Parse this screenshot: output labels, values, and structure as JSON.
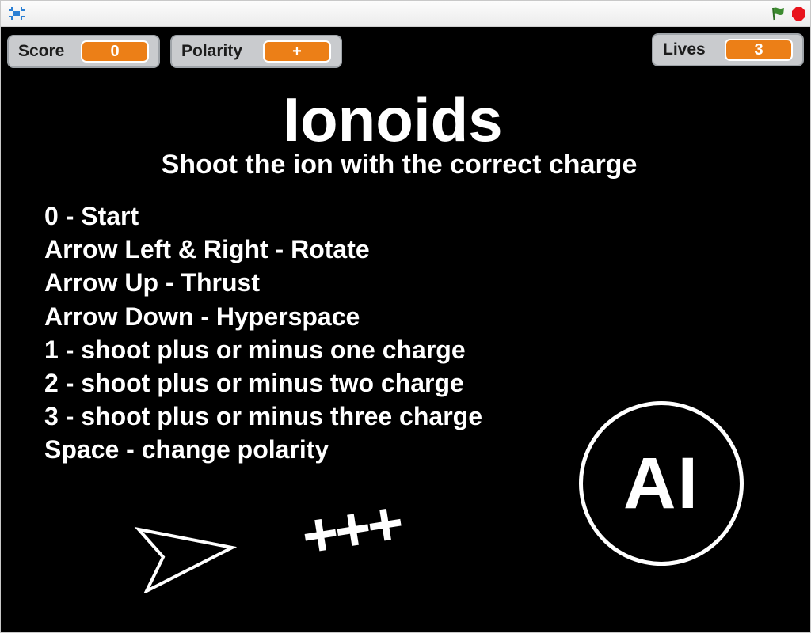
{
  "toolbar": {
    "fullscreen_icon": "fullscreen-icon",
    "green_flag_icon": "green-flag-icon",
    "stop_icon": "stop-sign-icon",
    "colors": {
      "fullscreen": "#2a7fd4",
      "flag": "#3c8a2f",
      "stop": "#e8141c"
    }
  },
  "monitors": {
    "score": {
      "label": "Score",
      "value": "0"
    },
    "polarity": {
      "label": "Polarity",
      "value": "+"
    },
    "lives": {
      "label": "Lives",
      "value": "3"
    },
    "colors": {
      "monitor_bg": "#c9cbce",
      "value_bg": "#ec7f17"
    }
  },
  "stage": {
    "title": "Ionoids",
    "subtitle": "Shoot the ion with the correct charge",
    "instructions": [
      "0 - Start",
      "Arrow Left & Right - Rotate",
      "Arrow Up - Thrust",
      "Arrow Down - Hyperspace",
      "1 - shoot plus or minus one charge",
      "2 - shoot plus or minus two charge",
      "3 - shoot plus or minus three charge",
      "Space - change polarity"
    ],
    "ion_sprite_text": "+++",
    "ai_badge_text": "AI",
    "ship_icon": "spaceship-icon"
  }
}
